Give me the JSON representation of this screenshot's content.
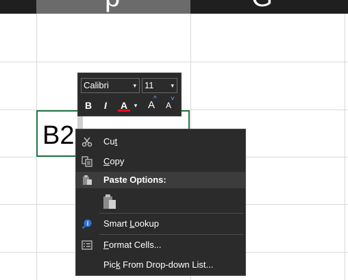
{
  "column_headers": {
    "left_glyph": "p",
    "right_glyph": "G"
  },
  "cell": {
    "text": "B2"
  },
  "mini_toolbar": {
    "font_name": "Calibri",
    "font_size": "11",
    "bold": "B",
    "italic": "I",
    "font_color": "A",
    "grow_font": "A",
    "shrink_font": "A",
    "grow_sup": "^",
    "shrink_sup": "˅",
    "dropdown": "▾"
  },
  "context_menu": {
    "cut_pre": "Cu",
    "cut_u": "t",
    "cut_post": "",
    "copy_pre": "",
    "copy_u": "C",
    "copy_post": "opy",
    "paste_options": "Paste Options:",
    "smart_pre": "Smart ",
    "smart_u": "L",
    "smart_post": "ookup",
    "format_pre": "",
    "format_u": "F",
    "format_post": "ormat Cells...",
    "pick_pre": "Pic",
    "pick_u": "k",
    "pick_post": " From Drop-down List..."
  },
  "colors": {
    "accent": "#217346",
    "menu_bg": "#2b2b2b",
    "font_color_bar": "#e81123"
  }
}
